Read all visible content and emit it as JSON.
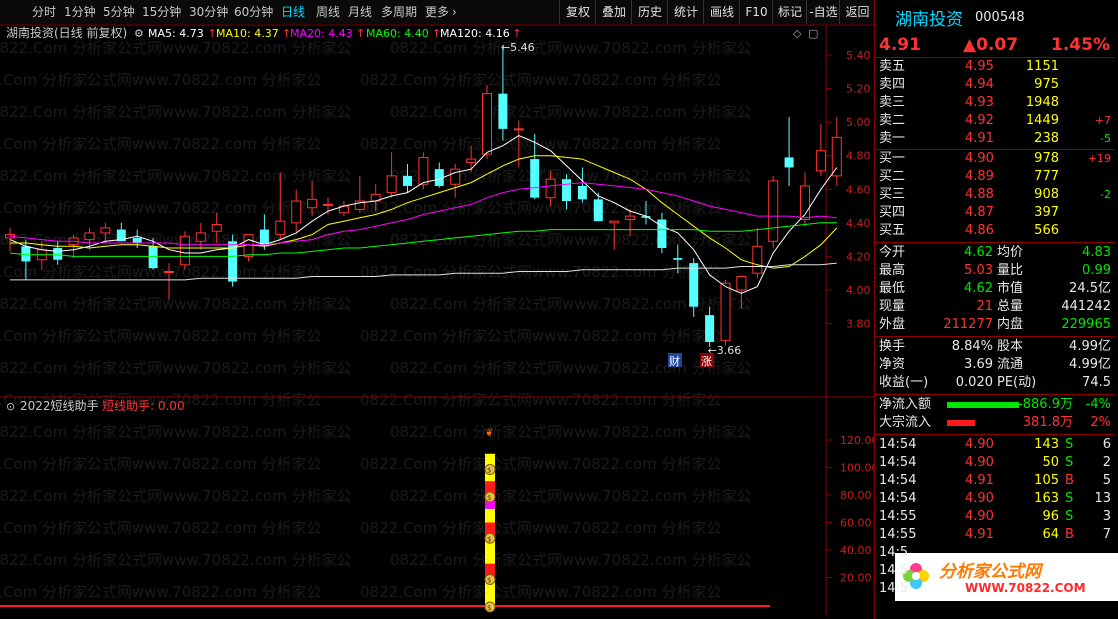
{
  "toolbar": {
    "periods": [
      "分时",
      "1分钟",
      "5分钟",
      "15分钟",
      "30分钟",
      "60分钟",
      "日线",
      "周线",
      "月线",
      "多周期",
      "更多"
    ],
    "active_period": "日线",
    "more_arrow": "›",
    "right_buttons": [
      "复权",
      "叠加",
      "历史",
      "统计",
      "画线",
      "F10",
      "标记",
      "-自选",
      "返回"
    ]
  },
  "main_chart": {
    "title": "湖南投资(日线 前复权)",
    "ma": [
      {
        "label": "MA5: 4.73",
        "color": "#ffffff"
      },
      {
        "label": "MA10: 4.37",
        "color": "#ffff00"
      },
      {
        "label": "MA20: 4.43",
        "color": "#ff00ff"
      },
      {
        "label": "MA60: 4.40",
        "color": "#00ff00"
      },
      {
        "label": "MA120: 4.16",
        "color": "#ffffff"
      }
    ],
    "y_ticks": [
      "5.40",
      "5.20",
      "5.00",
      "4.80",
      "4.60",
      "4.40",
      "4.20",
      "4.00",
      "3.80"
    ],
    "high_label": "5.46",
    "low_label": "3.66",
    "event_badges": [
      "财",
      "涨"
    ],
    "up_color": "#ff3232",
    "down_color": "#54ffff"
  },
  "chart_data": {
    "type": "candlestick",
    "ylim": [
      3.66,
      5.46
    ],
    "candles": [
      [
        4.31,
        4.37,
        4.23,
        4.33
      ],
      [
        4.26,
        4.3,
        4.06,
        4.17
      ],
      [
        4.18,
        4.29,
        4.12,
        4.24
      ],
      [
        4.25,
        4.29,
        4.15,
        4.18
      ],
      [
        4.27,
        4.33,
        4.19,
        4.31
      ],
      [
        4.3,
        4.37,
        4.24,
        4.34
      ],
      [
        4.34,
        4.4,
        4.28,
        4.37
      ],
      [
        4.36,
        4.4,
        4.29,
        4.29
      ],
      [
        4.31,
        4.36,
        4.25,
        4.28
      ],
      [
        4.26,
        4.31,
        4.12,
        4.13
      ],
      [
        4.11,
        4.16,
        3.94,
        4.11
      ],
      [
        4.15,
        4.35,
        4.12,
        4.32
      ],
      [
        4.29,
        4.4,
        4.24,
        4.34
      ],
      [
        4.35,
        4.46,
        4.28,
        4.39
      ],
      [
        4.29,
        4.33,
        4.02,
        4.05
      ],
      [
        4.2,
        4.33,
        4.17,
        4.33
      ],
      [
        4.36,
        4.45,
        4.24,
        4.26
      ],
      [
        4.33,
        4.7,
        4.3,
        4.41
      ],
      [
        4.4,
        4.6,
        4.34,
        4.53
      ],
      [
        4.49,
        4.65,
        4.44,
        4.54
      ],
      [
        4.51,
        4.55,
        4.45,
        4.51
      ],
      [
        4.46,
        4.53,
        4.44,
        4.5
      ],
      [
        4.48,
        4.68,
        4.46,
        4.53
      ],
      [
        4.53,
        4.63,
        4.47,
        4.57
      ],
      [
        4.58,
        4.82,
        4.55,
        4.68
      ],
      [
        4.68,
        4.75,
        4.58,
        4.62
      ],
      [
        4.63,
        4.82,
        4.6,
        4.79
      ],
      [
        4.72,
        4.76,
        4.61,
        4.62
      ],
      [
        4.63,
        4.75,
        4.55,
        4.72
      ],
      [
        4.76,
        4.86,
        4.7,
        4.78
      ],
      [
        4.81,
        5.22,
        4.78,
        5.17
      ],
      [
        5.17,
        5.46,
        4.89,
        4.96
      ],
      [
        4.96,
        5.01,
        4.73,
        4.96
      ],
      [
        4.78,
        4.93,
        4.54,
        4.55
      ],
      [
        4.55,
        4.71,
        4.5,
        4.66
      ],
      [
        4.66,
        4.69,
        4.48,
        4.53
      ],
      [
        4.62,
        4.73,
        4.52,
        4.54
      ],
      [
        4.54,
        4.58,
        4.41,
        4.41
      ],
      [
        4.4,
        4.41,
        4.24,
        4.41
      ],
      [
        4.42,
        4.48,
        4.32,
        4.44
      ],
      [
        4.44,
        4.53,
        4.39,
        4.43
      ],
      [
        4.42,
        4.46,
        4.22,
        4.25
      ],
      [
        4.19,
        4.27,
        4.1,
        4.18
      ],
      [
        4.16,
        4.19,
        3.84,
        3.9
      ],
      [
        3.85,
        3.9,
        3.66,
        3.69
      ],
      [
        3.7,
        4.06,
        3.67,
        4.04
      ],
      [
        4.0,
        4.08,
        3.89,
        4.08
      ],
      [
        4.1,
        4.37,
        4.07,
        4.26
      ],
      [
        4.29,
        4.68,
        4.25,
        4.65
      ],
      [
        4.79,
        5.03,
        4.62,
        4.73
      ],
      [
        4.42,
        4.7,
        4.38,
        4.62
      ],
      [
        4.71,
        4.99,
        4.68,
        4.83
      ],
      [
        4.68,
        5.03,
        4.62,
        4.91
      ]
    ],
    "ma_lines": {
      "MA5": [
        4.3,
        4.26,
        4.24,
        4.23,
        4.24,
        4.26,
        4.29,
        4.3,
        4.32,
        4.29,
        4.24,
        4.22,
        4.22,
        4.24,
        4.25,
        4.3,
        4.27,
        4.3,
        4.34,
        4.41,
        4.47,
        4.5,
        4.52,
        4.53,
        4.56,
        4.58,
        4.64,
        4.66,
        4.7,
        4.72,
        4.82,
        4.86,
        4.92,
        4.88,
        4.83,
        4.74,
        4.65,
        4.56,
        4.52,
        4.47,
        4.44,
        4.38,
        4.34,
        4.24,
        4.09,
        4.02,
        3.98,
        4.02,
        4.22,
        4.35,
        4.45,
        4.6,
        4.73
      ],
      "MA10": [
        4.28,
        4.28,
        4.27,
        4.26,
        4.26,
        4.25,
        4.26,
        4.27,
        4.27,
        4.26,
        4.25,
        4.25,
        4.25,
        4.25,
        4.25,
        4.27,
        4.26,
        4.28,
        4.3,
        4.33,
        4.39,
        4.41,
        4.43,
        4.45,
        4.48,
        4.52,
        4.55,
        4.58,
        4.61,
        4.64,
        4.69,
        4.74,
        4.78,
        4.8,
        4.8,
        4.79,
        4.78,
        4.74,
        4.7,
        4.66,
        4.6,
        4.52,
        4.45,
        4.38,
        4.31,
        4.25,
        4.18,
        4.15,
        4.13,
        4.14,
        4.2,
        4.27,
        4.37
      ],
      "MA20": [
        4.32,
        4.31,
        4.3,
        4.29,
        4.29,
        4.28,
        4.28,
        4.28,
        4.28,
        4.28,
        4.28,
        4.27,
        4.27,
        4.27,
        4.27,
        4.27,
        4.27,
        4.28,
        4.29,
        4.3,
        4.33,
        4.35,
        4.36,
        4.38,
        4.4,
        4.42,
        4.45,
        4.47,
        4.49,
        4.51,
        4.55,
        4.58,
        4.6,
        4.61,
        4.62,
        4.63,
        4.64,
        4.63,
        4.62,
        4.61,
        4.6,
        4.58,
        4.56,
        4.53,
        4.5,
        4.48,
        4.46,
        4.44,
        4.44,
        4.44,
        4.43,
        4.44,
        4.43
      ],
      "MA60": [
        4.22,
        4.21,
        4.21,
        4.21,
        4.2,
        4.2,
        4.2,
        4.2,
        4.2,
        4.2,
        4.2,
        4.2,
        4.2,
        4.2,
        4.2,
        4.21,
        4.21,
        4.22,
        4.22,
        4.23,
        4.24,
        4.25,
        4.25,
        4.26,
        4.27,
        4.28,
        4.29,
        4.3,
        4.31,
        4.32,
        4.33,
        4.34,
        4.35,
        4.35,
        4.36,
        4.36,
        4.36,
        4.36,
        4.36,
        4.36,
        4.36,
        4.36,
        4.36,
        4.36,
        4.35,
        4.35,
        4.35,
        4.36,
        4.37,
        4.38,
        4.39,
        4.4,
        4.4
      ],
      "MA120": [
        4.06,
        4.06,
        4.06,
        4.06,
        4.06,
        4.06,
        4.06,
        4.06,
        4.06,
        4.06,
        4.06,
        4.06,
        4.07,
        4.07,
        4.07,
        4.07,
        4.07,
        4.07,
        4.07,
        4.08,
        4.08,
        4.08,
        4.08,
        4.08,
        4.09,
        4.09,
        4.09,
        4.09,
        4.1,
        4.1,
        4.1,
        4.1,
        4.11,
        4.11,
        4.11,
        4.11,
        4.12,
        4.12,
        4.12,
        4.12,
        4.12,
        4.12,
        4.13,
        4.13,
        4.13,
        4.13,
        4.14,
        4.14,
        4.14,
        4.15,
        4.15,
        4.15,
        4.16
      ]
    }
  },
  "indicator": {
    "title": "2022短线助手",
    "subtitle": "短线助手: 0.00",
    "y_ticks": [
      "120.00",
      "100.00",
      "80.00",
      "60.00",
      "40.00",
      "20.00"
    ],
    "segments": [
      {
        "color": "#ffff00",
        "value": 20
      },
      {
        "color": "#ff1a1a",
        "value": 10
      },
      {
        "color": "#ffff00",
        "value": 20
      },
      {
        "color": "#ff1a1a",
        "value": 10
      },
      {
        "color": "#ffff00",
        "value": 10
      },
      {
        "color": "#ff00ff",
        "value": 10
      },
      {
        "color": "#ff1a1a",
        "value": 10
      },
      {
        "color": "#ffff00",
        "value": 20
      }
    ]
  },
  "watermark": {
    "text": "0822.Com 分析家公式网www.70822.com 分析家公"
  },
  "quote": {
    "name": "湖南投资",
    "code": "000548",
    "price": "4.91",
    "change": "▲0.07",
    "change_pct": "1.45%",
    "sell": [
      {
        "label": "卖五",
        "price": "4.95",
        "vol": "1151",
        "chg": ""
      },
      {
        "label": "卖四",
        "price": "4.94",
        "vol": "975",
        "chg": ""
      },
      {
        "label": "卖三",
        "price": "4.93",
        "vol": "1948",
        "chg": ""
      },
      {
        "label": "卖二",
        "price": "4.92",
        "vol": "1449",
        "chg": "+7"
      },
      {
        "label": "卖一",
        "price": "4.91",
        "vol": "238",
        "chg": "-5"
      }
    ],
    "buy": [
      {
        "label": "买一",
        "price": "4.90",
        "vol": "978",
        "chg": "+19"
      },
      {
        "label": "买二",
        "price": "4.89",
        "vol": "777",
        "chg": ""
      },
      {
        "label": "买三",
        "price": "4.88",
        "vol": "908",
        "chg": "-2"
      },
      {
        "label": "买四",
        "price": "4.87",
        "vol": "397",
        "chg": ""
      },
      {
        "label": "买五",
        "price": "4.86",
        "vol": "566",
        "chg": ""
      }
    ],
    "stats": [
      {
        "l1": "今开",
        "v1": "4.62",
        "c1": "grn",
        "l2": "均价",
        "v2": "4.83",
        "c2": "grn"
      },
      {
        "l1": "最高",
        "v1": "5.03",
        "c1": "red",
        "l2": "量比",
        "v2": "0.99",
        "c2": "grn"
      },
      {
        "l1": "最低",
        "v1": "4.62",
        "c1": "grn",
        "l2": "市值",
        "v2": "24.5亿",
        "c2": "wht"
      },
      {
        "l1": "现量",
        "v1": "21",
        "c1": "red",
        "l2": "总量",
        "v2": "441242",
        "c2": "wht"
      },
      {
        "l1": "外盘",
        "v1": "211277",
        "c1": "red",
        "l2": "内盘",
        "v2": "229965",
        "c2": "grn"
      }
    ],
    "stats2": [
      {
        "l1": "换手",
        "v1": "8.84%",
        "l2": "股本",
        "v2": "4.99亿"
      },
      {
        "l1": "净资",
        "v1": "3.69",
        "l2": "流通",
        "v2": "4.99亿"
      },
      {
        "l1": "收益(一)",
        "v1": "0.020",
        "l2": "PE(动)",
        "v2": "74.5"
      }
    ],
    "flows": [
      {
        "label": "净流入额",
        "bar_color": "#00e600",
        "bar_frac": 0.9,
        "value": "-886.9万",
        "pct": "-4%",
        "vcls": "grn"
      },
      {
        "label": "大宗流入",
        "bar_color": "#ff1a1a",
        "bar_frac": 0.35,
        "value": "381.8万",
        "pct": "2%",
        "vcls": "red"
      }
    ],
    "ticks": [
      {
        "time": "14:54",
        "price": "4.90",
        "vol": "143",
        "side": "S",
        "cnt": "6"
      },
      {
        "time": "14:54",
        "price": "4.90",
        "vol": "50",
        "side": "S",
        "cnt": "2"
      },
      {
        "time": "14:54",
        "price": "4.91",
        "vol": "105",
        "side": "B",
        "cnt": "5"
      },
      {
        "time": "14:54",
        "price": "4.90",
        "vol": "163",
        "side": "S",
        "cnt": "13"
      },
      {
        "time": "14:55",
        "price": "4.90",
        "vol": "96",
        "side": "S",
        "cnt": "3"
      },
      {
        "time": "14:55",
        "price": "4.91",
        "vol": "64",
        "side": "B",
        "cnt": "7"
      },
      {
        "time": "14:5",
        "price": "",
        "vol": "",
        "side": "",
        "cnt": ""
      },
      {
        "time": "14:5",
        "price": "",
        "vol": "",
        "side": "",
        "cnt": ""
      },
      {
        "time": "14:5",
        "price": "",
        "vol": "",
        "side": "",
        "cnt": ""
      }
    ]
  },
  "logo": {
    "name": "分析家公式网",
    "url": "WWW.70822.COM"
  }
}
